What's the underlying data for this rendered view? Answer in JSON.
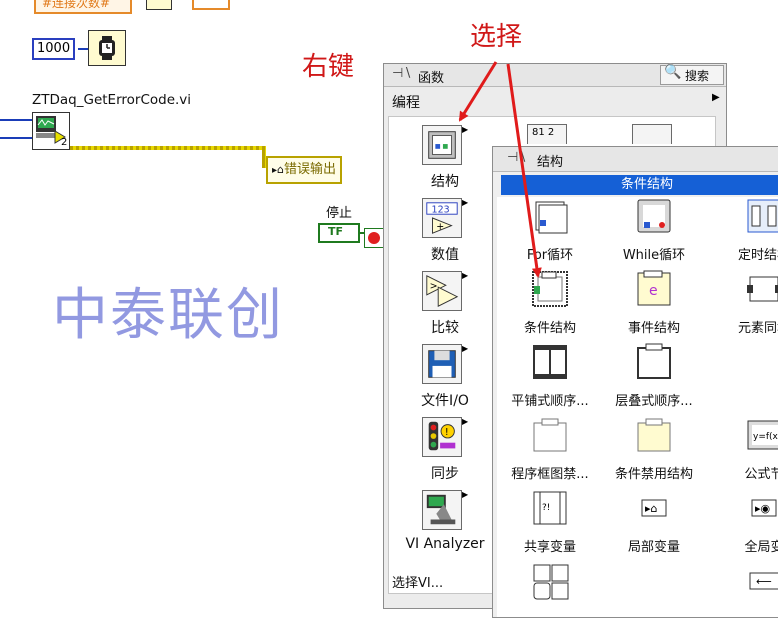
{
  "diagram": {
    "top_node_label": "#连接次数#",
    "numeric_constant": "1000",
    "subvi_name": "ZTDaq_GetErrorCode.vi",
    "subvi_terminal_digit": "2",
    "error_out_label": "错误输出",
    "stop_label": "停止",
    "bool_const": "TF",
    "watermark": "中泰联创"
  },
  "annotations": {
    "right_click": "右键",
    "select": "选择"
  },
  "functions_palette": {
    "title": "函数",
    "search": "搜索",
    "section": "编程",
    "categories": [
      {
        "label": "结构",
        "icon": "structures-icon"
      },
      {
        "label": "数值",
        "icon": "numeric-icon"
      },
      {
        "label": "比较",
        "icon": "comparison-icon"
      },
      {
        "label": "文件I/O",
        "icon": "file-io-icon"
      },
      {
        "label": "同步",
        "icon": "synchronization-icon"
      },
      {
        "label": "VI Analyzer",
        "icon": "vi-analyzer-icon"
      }
    ],
    "footer": "选择VI..."
  },
  "structures_palette": {
    "title": "结构",
    "selected_header": "条件结构",
    "items": [
      {
        "label": "For循环",
        "icon": "for-loop-icon"
      },
      {
        "label": "While循环",
        "icon": "while-loop-icon"
      },
      {
        "label": "定时结构",
        "icon": "timed-structure-icon"
      },
      {
        "label": "条件结构",
        "icon": "case-structure-icon"
      },
      {
        "label": "事件结构",
        "icon": "event-structure-icon"
      },
      {
        "label": "元素同址",
        "icon": "in-place-element-icon"
      },
      {
        "label": "平铺式顺序...",
        "icon": "flat-sequence-icon"
      },
      {
        "label": "层叠式顺序...",
        "icon": "stacked-sequence-icon"
      },
      {
        "label": "",
        "icon": ""
      },
      {
        "label": "程序框图禁...",
        "icon": "diagram-disable-icon"
      },
      {
        "label": "条件禁用结构",
        "icon": "conditional-disable-icon"
      },
      {
        "label": "公式节",
        "icon": "formula-node-icon"
      },
      {
        "label": "共享变量",
        "icon": "shared-variable-icon"
      },
      {
        "label": "局部变量",
        "icon": "local-variable-icon"
      },
      {
        "label": "全局变",
        "icon": "global-variable-icon"
      }
    ]
  },
  "colors": {
    "arrow": "#e01b1b",
    "wire_blue": "#1a3db8",
    "selection": "#1560d6"
  }
}
